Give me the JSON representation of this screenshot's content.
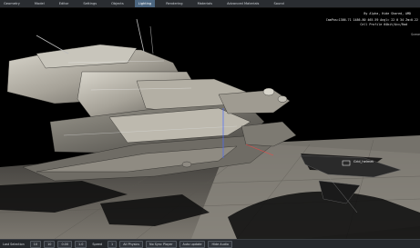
{
  "menubar": {
    "items": [
      {
        "label": "Geometry"
      },
      {
        "label": "Model"
      },
      {
        "label": "Editor"
      },
      {
        "label": "Settings"
      },
      {
        "label": "Objects"
      },
      {
        "label": "Lighting",
        "active": true
      },
      {
        "label": "Rendering"
      },
      {
        "label": "Materials"
      },
      {
        "label": "Advanced Materials"
      },
      {
        "label": "Sound"
      }
    ]
  },
  "viewport": {
    "credit": "By Alpha, Hide Shared, AMD",
    "camera_line1": "CamPos=1386.71 1486.80 465.59 Angl= 22  0  34 Zm=0.22",
    "camera_line2": "Cell Profile 64bit/Acc/Rad",
    "edge_label": "Scene",
    "hud_label": "Grid_helmet"
  },
  "statusbar": {
    "items": [
      {
        "label": "Last Selection",
        "type": "text"
      },
      {
        "label": "10",
        "type": "button"
      },
      {
        "label": "10",
        "type": "button"
      },
      {
        "label": "0.00",
        "type": "button"
      },
      {
        "label": "1.0",
        "type": "button"
      },
      {
        "label": "Speed",
        "type": "text"
      },
      {
        "label": "1",
        "type": "button"
      },
      {
        "label": "All Physics",
        "type": "button"
      },
      {
        "label": "No Sync Player",
        "type": "button"
      },
      {
        "label": "Auto update",
        "type": "button"
      },
      {
        "label": "Hide Audio",
        "type": "button"
      }
    ]
  }
}
